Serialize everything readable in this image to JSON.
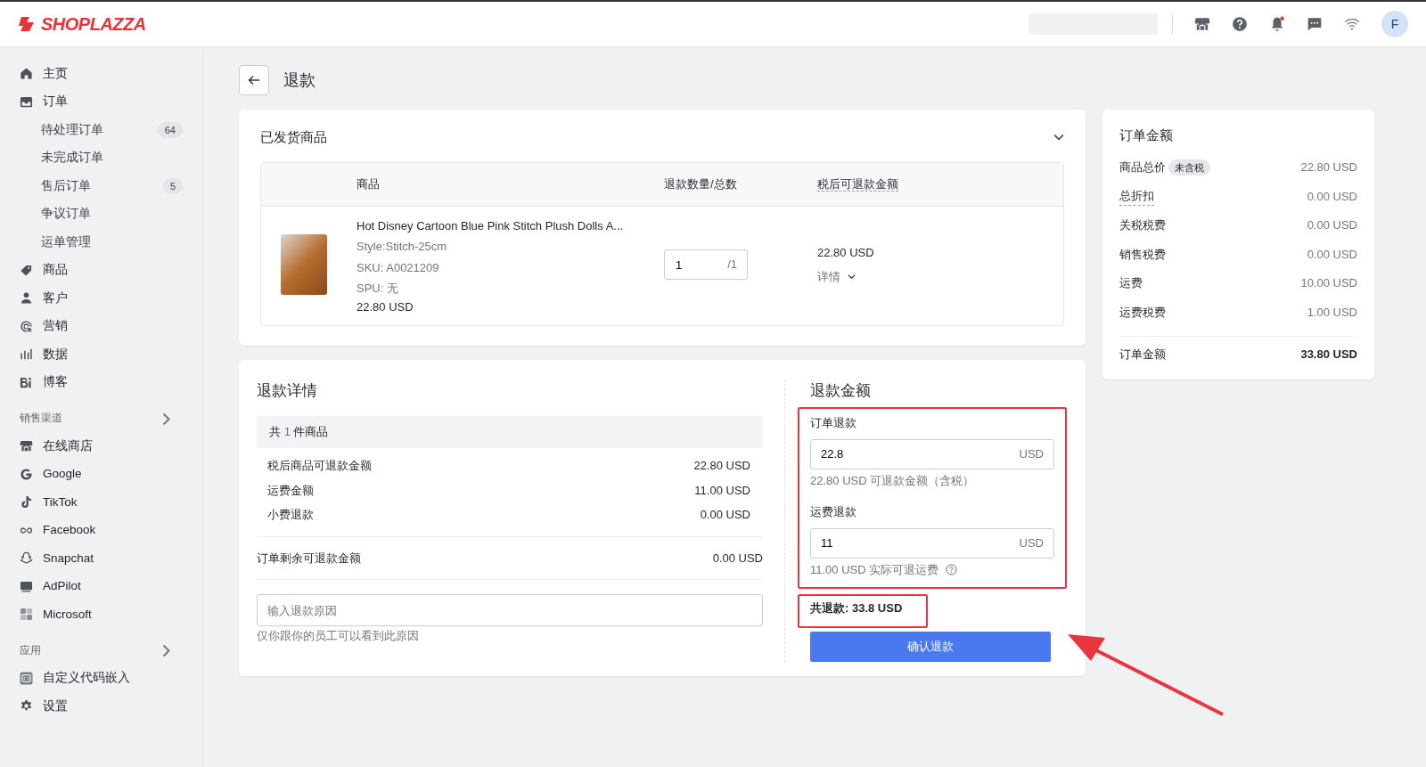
{
  "header": {
    "logo": "SHOPLAZZA",
    "avatar": "F",
    "notification_dot": true
  },
  "sidebar": {
    "items": [
      {
        "label": "主页",
        "kind": "main"
      },
      {
        "label": "订单",
        "kind": "main"
      },
      {
        "label": "待处理订单",
        "kind": "sub",
        "badge": "64"
      },
      {
        "label": "未完成订单",
        "kind": "sub"
      },
      {
        "label": "售后订单",
        "kind": "sub",
        "badge": "5"
      },
      {
        "label": "争议订单",
        "kind": "sub"
      },
      {
        "label": "运单管理",
        "kind": "sub"
      },
      {
        "label": "商品",
        "kind": "main"
      },
      {
        "label": "客户",
        "kind": "main"
      },
      {
        "label": "营销",
        "kind": "main"
      },
      {
        "label": "数据",
        "kind": "main"
      },
      {
        "label": "博客",
        "kind": "main"
      },
      {
        "label": "销售渠道",
        "kind": "section"
      },
      {
        "label": "在线商店",
        "kind": "main"
      },
      {
        "label": "Google",
        "kind": "main"
      },
      {
        "label": "TikTok",
        "kind": "main"
      },
      {
        "label": "Facebook",
        "kind": "main"
      },
      {
        "label": "Snapchat",
        "kind": "main"
      },
      {
        "label": "AdPilot",
        "kind": "main"
      },
      {
        "label": "Microsoft",
        "kind": "main"
      },
      {
        "label": "应用",
        "kind": "section"
      },
      {
        "label": "自定义代码嵌入",
        "kind": "main"
      },
      {
        "label": "设置",
        "kind": "main"
      }
    ]
  },
  "page": {
    "title": "退款"
  },
  "shipped": {
    "title": "已发货商品",
    "columns": [
      {
        "label": "商品",
        "dotted": false
      },
      {
        "label": "退款数量/总数",
        "dotted": false
      },
      {
        "label": "税后可退款金额",
        "dotted": true
      }
    ],
    "item": {
      "name": "Hot Disney Cartoon Blue Pink Stitch Plush Dolls A...",
      "style": "Style:Stitch-25cm",
      "sku": "SKU: A0021209",
      "spu": "SPU: 无",
      "price": "22.80 USD",
      "quantity": "1",
      "total": "/1",
      "refundable": "22.80 USD",
      "details": "详情"
    }
  },
  "refund_details": {
    "title": "退款详情",
    "count_prefix": "共",
    "count": "1",
    "count_suffix": "件商品",
    "lines": [
      {
        "label": "税后商品可退款金额",
        "value": "22.80 USD"
      },
      {
        "label": "运费金额",
        "value": "11.00 USD"
      },
      {
        "label": "小费退款",
        "value": "0.00 USD"
      }
    ],
    "remaining": {
      "label": "订单剩余可退款金额",
      "value": "0.00 USD"
    },
    "reason": {
      "placeholder": "输入退款原因",
      "hint": "仅你跟你的员工可以看到此原因"
    }
  },
  "refund_amount": {
    "title": "退款金额",
    "fields": [
      {
        "label": "订单退款",
        "value": "22.8",
        "unit": "USD",
        "hint": "22.80 USD 可退款金额（含税）",
        "help": false
      },
      {
        "label": "运费退款",
        "value": "11",
        "unit": "USD",
        "hint": "11.00 USD 实际可退运费",
        "help": true
      }
    ],
    "total": "共退款: 33.8 USD",
    "confirm": "确认退款"
  },
  "order_summary": {
    "title": "订单金额",
    "rows": [
      {
        "label": "商品总价",
        "tag": "未含税",
        "value": "22.80 USD",
        "dotted": false
      },
      {
        "label": "总折扣",
        "value": "0.00 USD",
        "dotted": true
      },
      {
        "label": "关税税费",
        "value": "0.00 USD",
        "dotted": false
      },
      {
        "label": "销售税费",
        "value": "0.00 USD",
        "dotted": false
      },
      {
        "label": "运费",
        "value": "10.00 USD",
        "dotted": false
      },
      {
        "label": "运费税费",
        "value": "1.00 USD",
        "dotted": false
      }
    ],
    "total": {
      "label": "订单金额",
      "value": "33.80 USD"
    }
  }
}
